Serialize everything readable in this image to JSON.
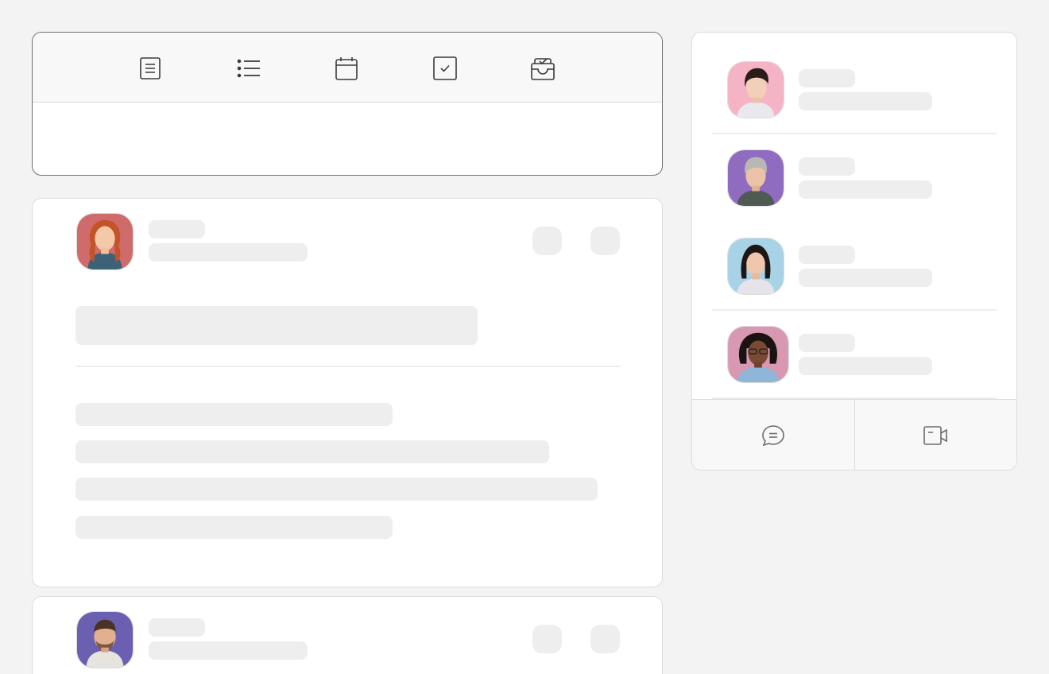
{
  "composer": {
    "tools": [
      {
        "icon": "document-icon"
      },
      {
        "icon": "list-icon"
      },
      {
        "icon": "calendar-icon"
      },
      {
        "icon": "checkbox-icon"
      },
      {
        "icon": "inbox-check-icon"
      }
    ],
    "input_value": ""
  },
  "posts": [
    {
      "avatar_bg": "#cf6b6a",
      "avatar_desc": "woman-red-hair"
    },
    {
      "avatar_bg": "#6a5fb0",
      "avatar_desc": "man-beard"
    }
  ],
  "contacts": {
    "people": [
      {
        "avatar_bg": "#f5b3c6"
      },
      {
        "avatar_bg": "#8f6cc0"
      },
      {
        "avatar_bg": "#a8d3e6"
      },
      {
        "avatar_bg": "#d898b2"
      }
    ],
    "actions": [
      {
        "icon": "chat-bubble-icon"
      },
      {
        "icon": "video-camera-icon"
      }
    ]
  },
  "colors": {
    "background": "#f4f3f4",
    "card": "#ffffff",
    "skeleton": "#efeeef",
    "border": "#dedcde",
    "icon": "#3a393b"
  }
}
